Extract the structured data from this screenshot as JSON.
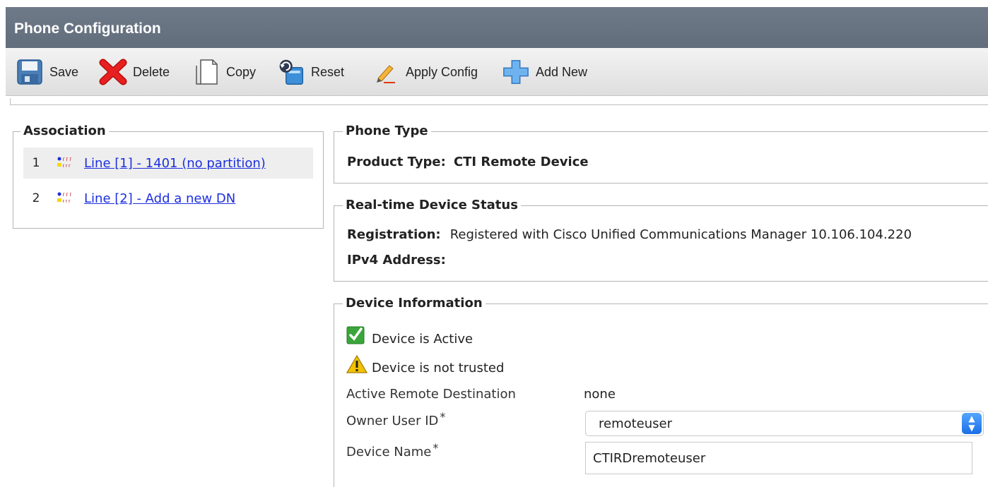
{
  "header": {
    "title": "Phone Configuration"
  },
  "toolbar": {
    "save_label": "Save",
    "delete_label": "Delete",
    "copy_label": "Copy",
    "reset_label": "Reset",
    "apply_config_label": "Apply Config",
    "add_new_label": "Add New"
  },
  "association": {
    "legend": "Association",
    "lines": [
      {
        "number": "1",
        "label": "Line [1] - 1401 (no partition)"
      },
      {
        "number": "2",
        "label": "Line [2] - Add a new DN"
      }
    ]
  },
  "phone_type": {
    "legend": "Phone Type",
    "product_type_label": "Product Type:",
    "product_type_value": "CTI Remote Device"
  },
  "status": {
    "legend": "Real-time Device Status",
    "registration_label": "Registration:",
    "registration_value": "Registered with Cisco Unified Communications Manager 10.106.104.220",
    "ipv4_label": "IPv4 Address:"
  },
  "device_info": {
    "legend": "Device Information",
    "active_text": "Device is Active",
    "trust_text": "Device is not trusted",
    "remote_dest_label": "Active Remote Destination",
    "remote_dest_value": "none",
    "owner_label": "Owner User ID",
    "owner_value": "remoteuser",
    "device_name_label": "Device Name",
    "device_name_value": "CTIRDremoteuser",
    "required_mark": "*"
  },
  "icon_names": [
    "save-icon",
    "delete-icon",
    "copy-icon",
    "reset-icon",
    "apply-config-icon",
    "add-new-icon",
    "line-icon",
    "check-icon",
    "warning-icon"
  ],
  "colors": {
    "header_bg": "#6a7584",
    "link": "#1d2fe0",
    "check": "#3aa53a",
    "warning": "#f2c200",
    "delete": "#e01010",
    "add": "#3c8fe0"
  }
}
